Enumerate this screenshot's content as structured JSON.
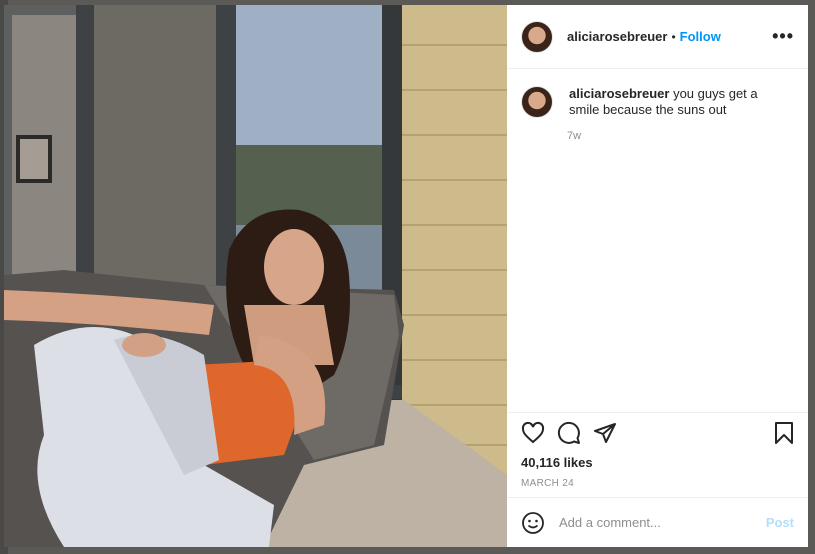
{
  "post": {
    "username": "aliciarosebreuer",
    "separator": "•",
    "follow_label": "Follow",
    "more_icon": "more-options-icon",
    "caption": {
      "username": "aliciarosebreuer",
      "text": "you guys get a smile because the suns out",
      "time": "7w"
    },
    "likes": "40,116 likes",
    "date": "MARCH 24",
    "icons": [
      "heart-icon",
      "comment-icon",
      "share-icon",
      "bookmark-icon",
      "emoji-icon"
    ],
    "comment_placeholder": "Add a comment...",
    "post_label": "Post"
  },
  "colors": {
    "accent": "#0095f6",
    "post_disabled": "#b2dffc",
    "text": "#262626",
    "secondary": "#8e8e8e"
  }
}
